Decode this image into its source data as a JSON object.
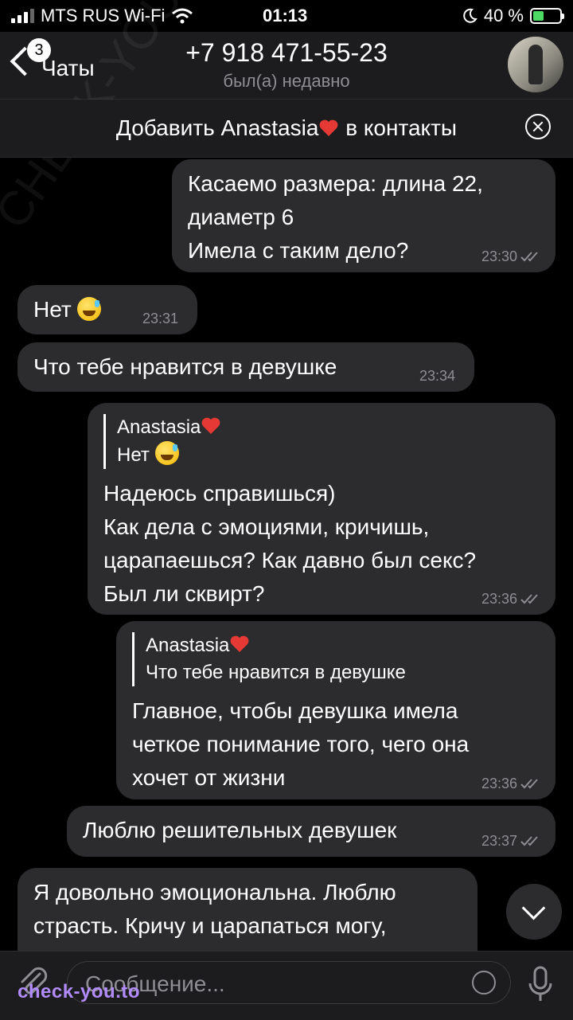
{
  "status_bar": {
    "carrier": "MTS RUS Wi-Fi",
    "time": "01:13",
    "battery": "40 %",
    "battery_level": 0.4
  },
  "header": {
    "back_label": "Чаты",
    "unread_count": "3",
    "title": "+7 918 471-55-23",
    "subtitle": "был(а) недавно"
  },
  "add_contact": {
    "prefix": "Добавить Anastasia",
    "suffix": "в контакты"
  },
  "messages": [
    {
      "dir": "out",
      "text": "Касаемо размера: длина 22,\nдиаметр 6\nИмела с таким дело?",
      "time": "23:30"
    },
    {
      "dir": "in",
      "text": "Нет",
      "time": "23:31"
    },
    {
      "dir": "in",
      "text": "Что тебе нравится в девушке",
      "time": "23:34"
    },
    {
      "dir": "out",
      "reply_name": "Anastasia",
      "reply_text": "Нет",
      "text": "Надеюсь справишься)\nКак дела с эмоциями, кричишь,\nцарапаешься? Как давно был секс?\nБыл ли сквирт?",
      "time": "23:36"
    },
    {
      "dir": "out",
      "reply_name": "Anastasia",
      "reply_text": "Что тебе нравится в девушке",
      "text": "Главное, чтобы девушка имела\nчеткое понимание того, чего она\nхочет от жизни",
      "time": "23:36"
    },
    {
      "dir": "out",
      "text": "Люблю решительных девушек",
      "time": "23:37"
    },
    {
      "dir": "in",
      "text": "Я довольно эмоциональна. Люблю\nстрасть. Кричу и царапаться могу,",
      "time": ""
    }
  ],
  "input": {
    "placeholder": "Сообщение..."
  },
  "watermark": "check-you.to",
  "watermark_diag": "CHECK-YOU.ME",
  "colors": {
    "bubble": "#2c2c2e",
    "bar": "#1c1c1e",
    "battery": "#4cd964",
    "watermark": "#b28bff"
  },
  "icons": [
    "wifi-icon",
    "moon-icon",
    "battery-icon",
    "back-chevron-icon",
    "heart-icon",
    "close-circle-icon",
    "double-check-icon",
    "emoji-sweat-smile-icon",
    "chevron-down-icon",
    "paperclip-icon",
    "sticker-icon",
    "mic-icon"
  ]
}
